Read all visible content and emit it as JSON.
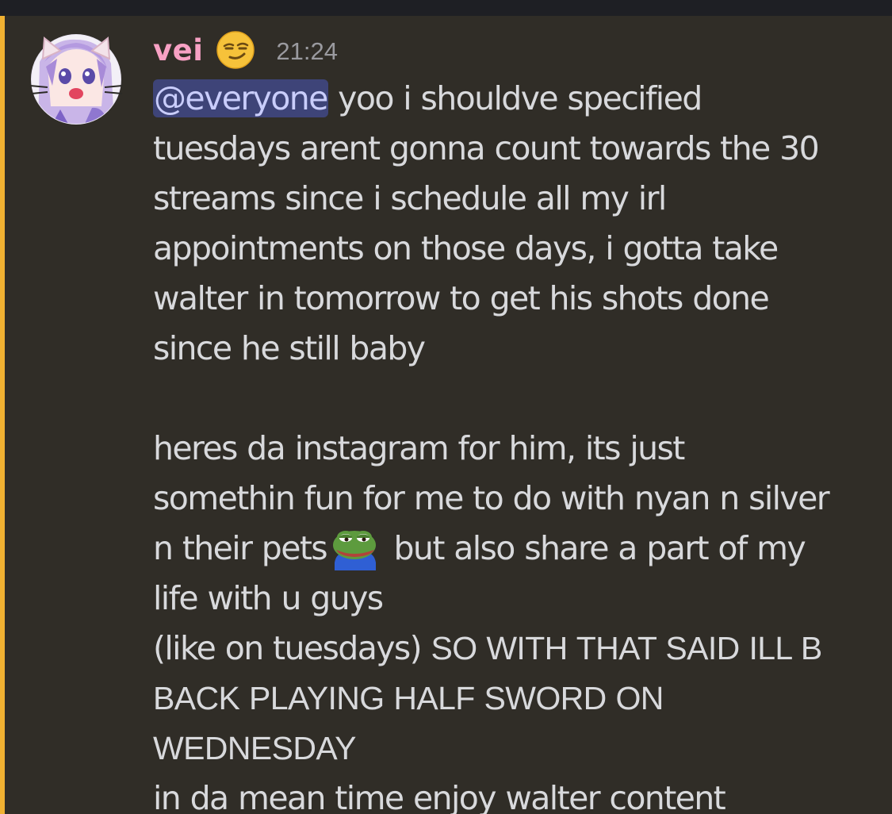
{
  "message": {
    "author": "vei",
    "author_emoji": "smirk-emoji",
    "timestamp": "21:24",
    "mention": "@everyone",
    "text_1": " yoo i shouldve specified\ntuesdays arent gonna count towards the 30\nstreams since i schedule all my irl\nappointments on those days, i gotta take\nwalter in tomorrow to get his shots done\nsince he still baby\n\nheres da instagram for him, its just\nsomethin fun for me to do with nyan n silver\nn their pets",
    "inline_emoji": "pepe-frog-emoji",
    "text_2": " but also share a part of my\nlife with u guys\n(like on tuesdays) ",
    "text_caps": "SO WITH THAT SAID ILL B\nBACK PLAYING HALF SWORD ON\nWEDNESDAY",
    "text_3": "\nin da mean time enjoy walter content"
  },
  "colors": {
    "mention_bar": "#f0b132",
    "username": "#f7a1c4",
    "mention_bg": "#3e4478",
    "mention_text": "#c9cdfb",
    "body_text": "#d8d9dc",
    "timestamp": "#9a9a9f"
  }
}
